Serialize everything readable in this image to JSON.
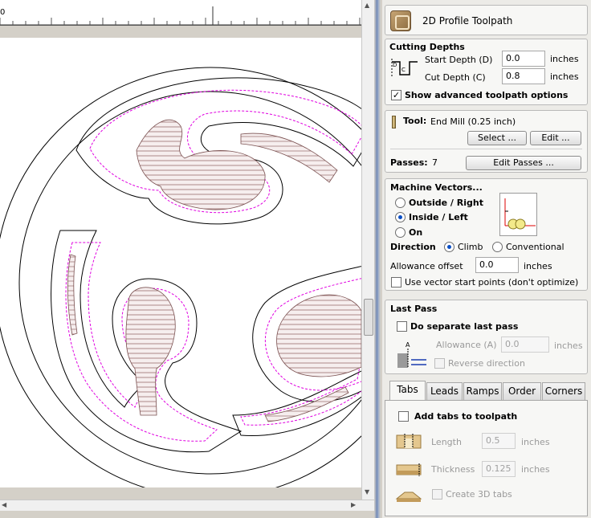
{
  "ruler": {
    "label": "0"
  },
  "title": {
    "text": "2D Profile Toolpath"
  },
  "cutting_depths": {
    "heading": "Cutting Depths",
    "start_label": "Start Depth (D)",
    "start_value": "0.0",
    "start_unit": "inches",
    "cut_label": "Cut Depth (C)",
    "cut_value": "0.8",
    "cut_unit": "inches",
    "advanced_label": "Show advanced toolpath options",
    "advanced_checked": true
  },
  "tool": {
    "label": "Tool:",
    "value": "End Mill (0.25 inch)",
    "select_btn": "Select ...",
    "edit_btn": "Edit ...",
    "passes_label": "Passes:",
    "passes_value": "7",
    "edit_passes_btn": "Edit Passes ..."
  },
  "machine_vectors": {
    "heading": "Machine Vectors...",
    "opt_outside": "Outside / Right",
    "opt_inside": "Inside / Left",
    "opt_on": "On",
    "selected": "Inside / Left",
    "direction_label": "Direction",
    "dir_climb": "Climb",
    "dir_conventional": "Conventional",
    "direction_selected": "Climb",
    "allowance_label": "Allowance offset",
    "allowance_value": "0.0",
    "allowance_unit": "inches",
    "start_points_label": "Use vector start points (don't optimize)"
  },
  "last_pass": {
    "heading": "Last Pass",
    "separate_label": "Do separate last pass",
    "allowance_label": "Allowance (A)",
    "allowance_value": "0.0",
    "allowance_unit": "inches",
    "reverse_label": "Reverse direction"
  },
  "tabs": {
    "items": [
      "Tabs",
      "Leads",
      "Ramps",
      "Order",
      "Corners"
    ],
    "active": "Tabs",
    "add_tabs_label": "Add tabs to toolpath",
    "length_label": "Length",
    "length_value": "0.5",
    "length_unit": "inches",
    "thickness_label": "Thickness",
    "thickness_value": "0.125",
    "thickness_unit": "inches",
    "create3d_label": "Create 3D tabs"
  },
  "colors": {
    "offset_line": "#e000e0",
    "pocket_fill": "#c9a7a7",
    "accent": "#0a4ec4"
  }
}
